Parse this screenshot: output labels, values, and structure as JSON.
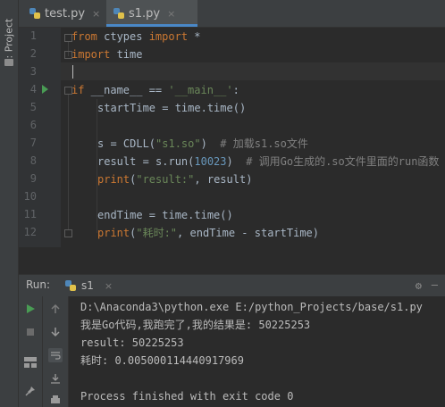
{
  "sidebar": {
    "project_label": "1: Project"
  },
  "tabs": [
    {
      "label": "test.py",
      "close": "×"
    },
    {
      "label": "s1.py",
      "close": "×"
    }
  ],
  "editor": {
    "line_numbers": [
      "1",
      "2",
      "3",
      "4",
      "5",
      "6",
      "7",
      "8",
      "9",
      "10",
      "11",
      "12"
    ],
    "lines": {
      "l1_kw1": "from",
      "l1_mod": " ctypes ",
      "l1_kw2": "import",
      "l1_rest": " *",
      "l2_kw": "import",
      "l2_rest": " time",
      "l4_kw": "if",
      "l4_mid": " __name__ == ",
      "l4_str": "'__main__'",
      "l4_end": ":",
      "l5": "startTime = time.time()",
      "l7_a": "s = CDLL(",
      "l7_str": "\"s1.so\"",
      "l7_b": ")  ",
      "l7_com": "# 加载s1.so文件",
      "l8_a": "result = s.run(",
      "l8_num": "10023",
      "l8_b": ")  ",
      "l8_com": "# 调用Go生成的.so文件里面的run函数",
      "l9_kw": "print",
      "l9_a": "(",
      "l9_str": "\"result:\"",
      "l9_b": ", result)",
      "l11": "endTime = time.time()",
      "l12_kw": "print",
      "l12_a": "(",
      "l12_str": "\"耗时:\"",
      "l12_b": ", endTime - startTime)"
    }
  },
  "run_panel": {
    "label": "Run:",
    "tab": "s1",
    "close": "×",
    "gear_icon": "gear-icon",
    "console": [
      "D:\\Anaconda3\\python.exe E:/python_Projects/base/s1.py",
      "我是Go代码,我跑完了,我的结果是: 50225253",
      "result: 50225253",
      "耗时: 0.005000114440917969",
      "",
      "Process finished with exit code 0"
    ]
  }
}
